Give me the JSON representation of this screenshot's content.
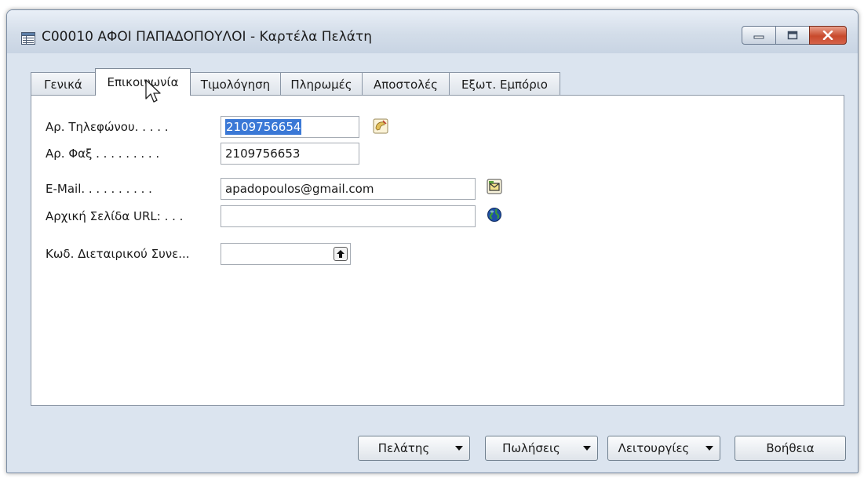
{
  "window": {
    "title": "C00010 ΑΦΟΙ ΠΑΠΑΔΟΠΟΥΛΟΙ - Καρτέλα Πελάτη",
    "title_icon": "table-form-icon"
  },
  "tabs": [
    {
      "label": "Γενικά",
      "active": false
    },
    {
      "label": "Επικοινωνία",
      "active": true
    },
    {
      "label": "Τιμολόγηση",
      "active": false
    },
    {
      "label": "Πληρωμές",
      "active": false
    },
    {
      "label": "Αποστολές",
      "active": false
    },
    {
      "label": "Εξωτ. Εμπόριο",
      "active": false
    }
  ],
  "fields": {
    "phone": {
      "label": "Αρ. Τηλεφώνου. . . . .",
      "value": "2109756654",
      "icon": "phone-dial-icon"
    },
    "fax": {
      "label": "Αρ. Φαξ . . . . . . . . .",
      "value": "2109756653"
    },
    "email": {
      "label": "E-Mail. . . . . . . . . .",
      "value": "apadopoulos@gmail.com",
      "icon": "mail-envelope-icon"
    },
    "homepage": {
      "label": "Αρχική Σελίδα URL: . . .",
      "value": "",
      "icon": "globe-icon"
    },
    "ic_partner": {
      "label": "Κωδ. Διεταιρικού Συνε...",
      "value": "",
      "icon": "lookup-arrow-icon"
    }
  },
  "buttons": {
    "customer": "Πελάτης",
    "sales": "Πωλήσεις",
    "functions": "Λειτουργίες",
    "help": "Βοήθεια"
  },
  "colors": {
    "selection": "#3a78d6",
    "close_button": "#c84a2c",
    "window_frame": "#dbe4ef"
  }
}
